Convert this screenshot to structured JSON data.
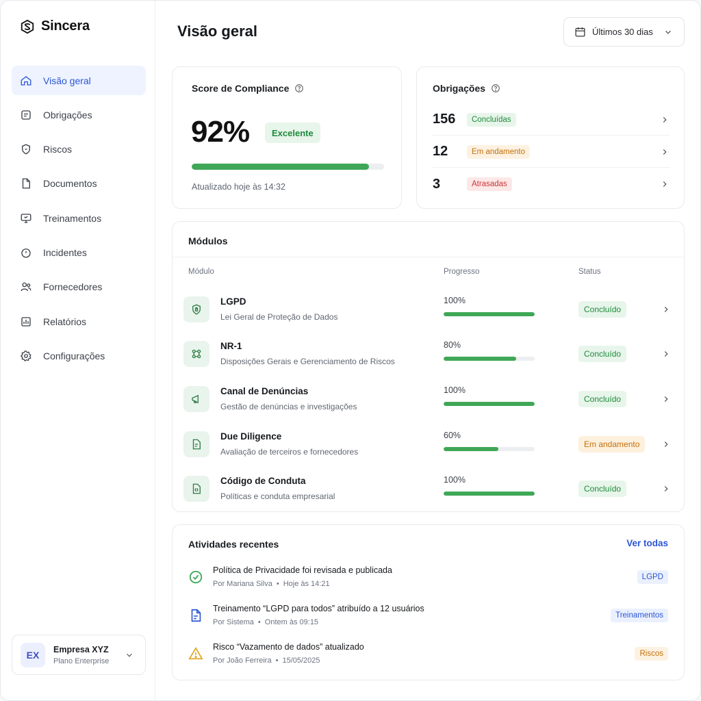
{
  "app": {
    "name": "Sincera"
  },
  "sidebar": {
    "items": [
      {
        "label": "Visão geral",
        "icon": "home-icon",
        "active": true
      },
      {
        "label": "Obrigações",
        "icon": "checklist-icon"
      },
      {
        "label": "Riscos",
        "icon": "shield-icon"
      },
      {
        "label": "Documentos",
        "icon": "document-icon"
      },
      {
        "label": "Treinamentos",
        "icon": "monitor-icon"
      },
      {
        "label": "Incidentes",
        "icon": "alert-circle-icon"
      },
      {
        "label": "Fornecedores",
        "icon": "users-icon"
      },
      {
        "label": "Relatórios",
        "icon": "bar-chart-icon"
      },
      {
        "label": "Configurações",
        "icon": "gear-icon"
      }
    ],
    "company": {
      "initials": "EX",
      "name": "Empresa XYZ",
      "plan": "Plano Enterprise"
    }
  },
  "header": {
    "title": "Visão geral",
    "date_filter": "Últimos 30 dias"
  },
  "score": {
    "title": "Score de Compliance",
    "value": "92%",
    "progress": 0.92,
    "badge": "Excelente",
    "updated": "Atualizado hoje às 14:32"
  },
  "obligations": {
    "title": "Obrigações",
    "rows": [
      {
        "count": "156",
        "label": "Concluídas",
        "color": "green"
      },
      {
        "count": "12",
        "label": "Em andamento",
        "color": "orange"
      },
      {
        "count": "3",
        "label": "Atrasadas",
        "color": "red"
      }
    ]
  },
  "modules": {
    "title": "Módulos",
    "columns": {
      "module": "Módulo",
      "progress": "Progresso",
      "status": "Status"
    },
    "rows": [
      {
        "name": "LGPD",
        "desc": "Lei Geral de Proteção de Dados",
        "pct": "100%",
        "progress": 1.0,
        "status": "Concluído",
        "status_color": "green",
        "icon": "shield-lock-icon"
      },
      {
        "name": "NR-1",
        "desc": "Disposições Gerais e Gerenciamento de Riscos",
        "pct": "80%",
        "progress": 0.8,
        "status": "Concluído",
        "status_color": "green",
        "icon": "network-icon"
      },
      {
        "name": "Canal de Denúncias",
        "desc": "Gestão de denúncias e investigações",
        "pct": "100%",
        "progress": 1.0,
        "status": "Concluído",
        "status_color": "green",
        "icon": "megaphone-icon"
      },
      {
        "name": "Due Diligence",
        "desc": "Avaliação de terceiros e fornecedores",
        "pct": "60%",
        "progress": 0.6,
        "status": "Em andamento",
        "status_color": "orange",
        "icon": "document-search-icon"
      },
      {
        "name": "Código de Conduta",
        "desc": "Políticas e conduta empresarial",
        "pct": "100%",
        "progress": 1.0,
        "status": "Concluído",
        "status_color": "green",
        "icon": "document-code-icon"
      }
    ]
  },
  "activities": {
    "title": "Atividades recentes",
    "see_all": "Ver todas",
    "items": [
      {
        "title": "Política de Privacidade foi revisada e publicada",
        "author": "Por Mariana Silva",
        "when": "Hoje às 14:21",
        "tag": "LGPD",
        "tag_color": "blue",
        "icon": "check-circle-icon"
      },
      {
        "title": "Treinamento “LGPD para todos” atribuído a 12 usuários",
        "author": "Por Sistema",
        "when": "Ontem às 09:15",
        "tag": "Treinamentos",
        "tag_color": "blue",
        "icon": "document-icon"
      },
      {
        "title": "Risco “Vazamento de dados” atualizado",
        "author": "Por João Ferreira",
        "when": "15/05/2025",
        "tag": "Riscos",
        "tag_color": "orange",
        "icon": "warning-icon"
      }
    ]
  },
  "colors": {
    "accent": "#2b55d6",
    "success": "#3fa757",
    "warning": "#c2710c",
    "danger": "#c93636"
  }
}
